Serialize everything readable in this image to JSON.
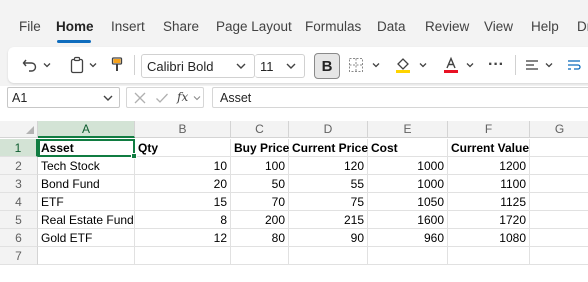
{
  "menu": {
    "tabs": [
      "File",
      "Home",
      "Insert",
      "Share",
      "Page Layout",
      "Formulas",
      "Data",
      "Review",
      "View",
      "Help",
      "Dr"
    ]
  },
  "ribbon": {
    "font_name": "Calibri Bold",
    "font_size": "11",
    "bold_label": "B",
    "more_label": "···",
    "colors": {
      "fill_highlight": "#ffd400",
      "font_color": "#e81123",
      "accent": "#107c41"
    }
  },
  "formula_bar": {
    "cell_ref": "A1",
    "formula": "Asset",
    "fx_label": "fx"
  },
  "grid": {
    "columns": [
      "A",
      "B",
      "C",
      "D",
      "E",
      "F",
      "G"
    ],
    "row_numbers": [
      "1",
      "2",
      "3",
      "4",
      "5",
      "6",
      "7"
    ],
    "rows": [
      [
        "Asset",
        "Qty",
        "Buy Price",
        "Current Price",
        "Cost",
        "Current Value",
        ""
      ],
      [
        "Tech Stock",
        "10",
        "100",
        "120",
        "1000",
        "1200",
        ""
      ],
      [
        "Bond Fund",
        "20",
        "50",
        "55",
        "1000",
        "1100",
        ""
      ],
      [
        "ETF",
        "15",
        "70",
        "75",
        "1050",
        "1125",
        ""
      ],
      [
        "Real Estate Fund",
        "8",
        "200",
        "215",
        "1600",
        "1720",
        ""
      ],
      [
        "Gold ETF",
        "12",
        "80",
        "90",
        "960",
        "1080",
        ""
      ],
      [
        "",
        "",
        "",
        "",
        "",
        "",
        ""
      ]
    ]
  }
}
